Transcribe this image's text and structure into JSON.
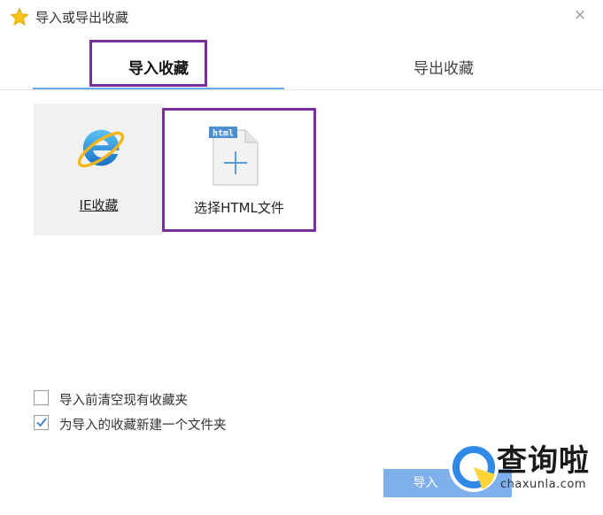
{
  "window": {
    "title": "导入或导出收藏",
    "close_symbol": "×"
  },
  "tabs": [
    {
      "label": "导入收藏",
      "active": true
    },
    {
      "label": "导出收藏",
      "active": false
    }
  ],
  "sources": {
    "ie": {
      "label": "IE收藏",
      "icon": "ie-browser-icon"
    },
    "html": {
      "label": "选择HTML文件",
      "badge": "html",
      "icon": "html-file-add-icon"
    }
  },
  "options": [
    {
      "label": "导入前清空现有收藏夹",
      "checked": false
    },
    {
      "label": "为导入的收藏新建一个文件夹",
      "checked": true
    }
  ],
  "buttons": {
    "import_label": "导入"
  },
  "watermark": {
    "text": "查询啦",
    "url": "chaxunla.com"
  },
  "colors": {
    "highlight": "#7b2f9f",
    "accent": "#6aa8e8",
    "button": "#7fb0ec"
  }
}
